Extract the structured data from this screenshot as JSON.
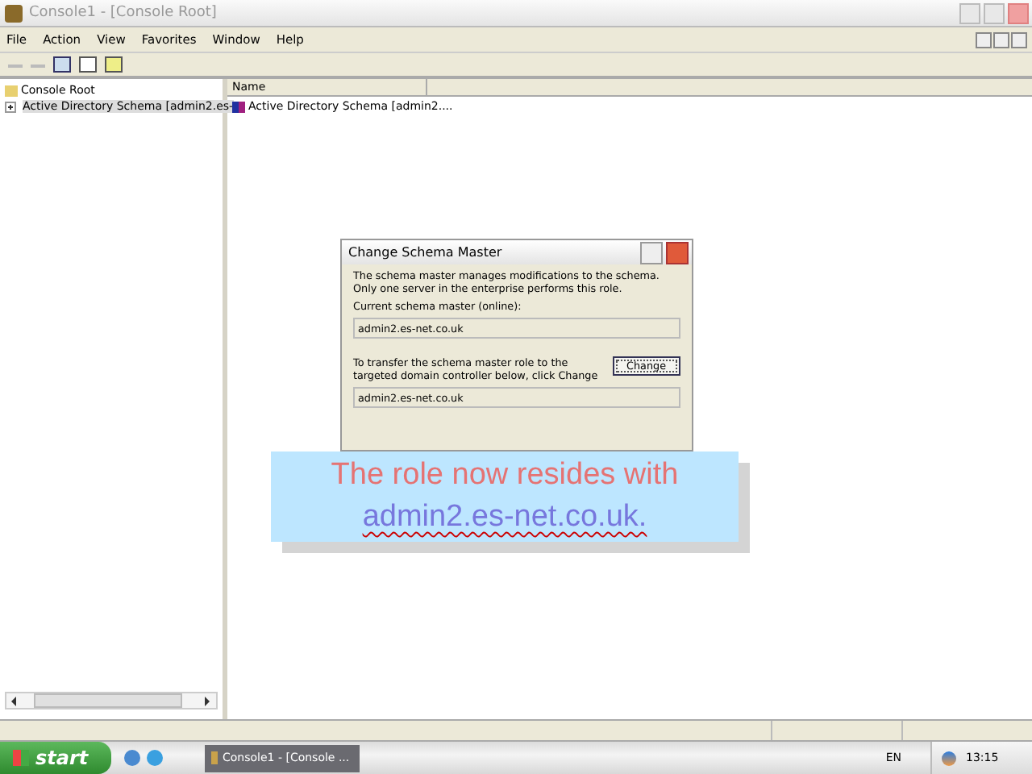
{
  "window": {
    "title": "Console1 - [Console Root]"
  },
  "menu": [
    "File",
    "Action",
    "View",
    "Favorites",
    "Window",
    "Help"
  ],
  "tree": [
    {
      "label": "Console Root",
      "children": [
        {
          "label": "Active Directory Schema [admin2.es-",
          "expanded": false
        }
      ]
    }
  ],
  "list": {
    "columns": [
      "Name"
    ],
    "rows": [
      "Active Directory Schema [admin2...."
    ]
  },
  "dialog": {
    "title": "Change Schema Master",
    "description": "The schema master manages modifications to the schema. Only one server in the enterprise performs this role.",
    "current_label": "Current schema master (online):",
    "current_value": "admin2.es-net.co.uk",
    "transfer_text": "To transfer the schema master role to the targeted domain controller below, click Change",
    "button": "Change",
    "target_value": "admin2.es-net.co.uk"
  },
  "callout": {
    "lines": [
      "The role now resides with",
      "admin2.es-net.co.uk."
    ]
  },
  "taskbar": {
    "start": "start",
    "task": "Console1 - [Console ...",
    "language": "EN",
    "clock": "13:15"
  }
}
